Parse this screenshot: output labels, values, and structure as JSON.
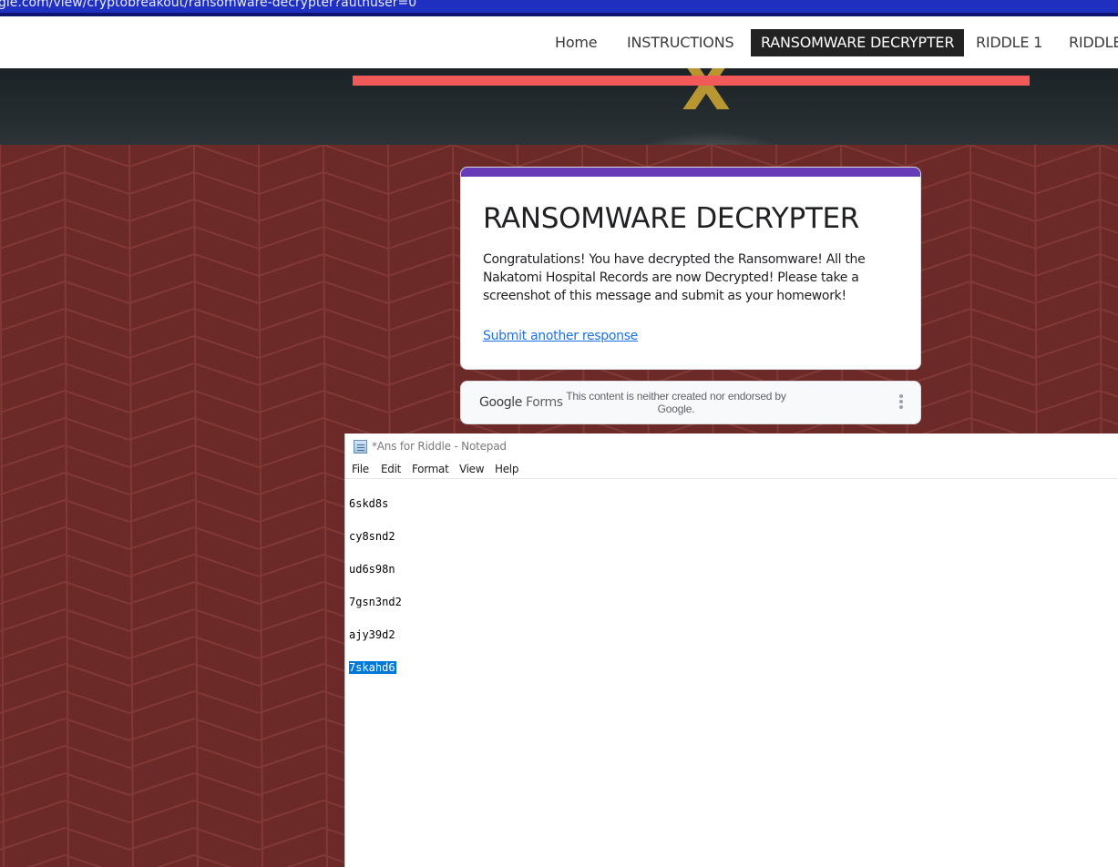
{
  "browser": {
    "url_fragment": "gle.com/view/cryptobreakout/ransomware-decrypter?authuser=0"
  },
  "nav": {
    "items": [
      {
        "label": "Home",
        "active": false
      },
      {
        "label": "INSTRUCTIONS",
        "active": false
      },
      {
        "label": "RANSOMWARE DECRYPTER",
        "active": true
      },
      {
        "label": "RIDDLE 1",
        "active": false
      },
      {
        "label": "RIDDLE",
        "active": false
      }
    ]
  },
  "form": {
    "title": "RANSOMWARE DECRYPTER",
    "message": "Congratulations!  You have decrypted the Ransomware!  All the Nakatomi Hospital Records are now Decrypted!  Please take a screenshot of this message and submit as your homework!",
    "link_label": "Submit another response",
    "accent_color": "#673ab7"
  },
  "forms_footer": {
    "logo_google": "Google",
    "logo_forms": "Forms",
    "disclaimer": "This content is neither created nor endorsed by Google."
  },
  "notepad": {
    "title": "*Ans for Riddle - Notepad",
    "menu": [
      "File",
      "Edit",
      "Format",
      "View",
      "Help"
    ],
    "lines": [
      "6skd8s",
      "cy8snd2",
      "ud6s98n",
      "7gsn3nd2",
      "ajy39d2",
      "7skahd6"
    ],
    "selected_line_index": 5
  },
  "colors": {
    "background": "#6b2a28",
    "hero_bar": "#f25a5a",
    "nav_active": "#222222",
    "selection": "#0078d7"
  }
}
